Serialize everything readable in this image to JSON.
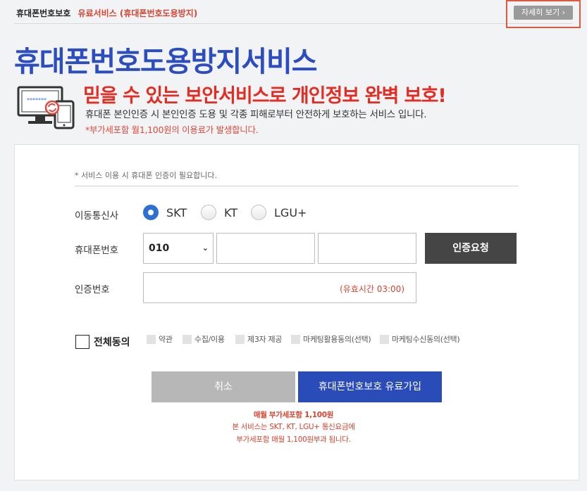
{
  "breadcrumb": {
    "home": "휴대폰번호보호",
    "current": "유료서비스 (휴대폰번호도용방지)"
  },
  "detail_button": "자세히 보기 ›",
  "title": "휴대폰번호도용방지서비스",
  "headline": "믿을 수 있는 보안서비스로 개인정보 완벽 보호!",
  "subtext": "휴대폰 본인인증 시 본인인증 도용 및 각종 피해로부터 안전하게 보호하는 서비스 입니다.",
  "fee_notice": "*부가세포함 월1,100원의 이용료가 발생합니다.",
  "form": {
    "notice": "* 서비스 이용 시 휴대폰 인증이 필요합니다.",
    "carrier_label": "이동통신사",
    "carriers": [
      {
        "label": "SKT",
        "selected": true
      },
      {
        "label": "KT",
        "selected": false
      },
      {
        "label": "LGU+",
        "selected": false
      }
    ],
    "phone_label": "휴대폰번호",
    "phone_prefix": "010",
    "phone_middle": "",
    "phone_last": "",
    "auth_button": "인증요청",
    "code_label": "인증번호",
    "code_value": "",
    "timer": "(유효시간 03:00)"
  },
  "agreements": {
    "all": "전체동의",
    "items": [
      "약관",
      "수집/이용",
      "제3자 제공",
      "마케팅활용동의(선택)",
      "마케팅수신동의(선택)"
    ]
  },
  "buttons": {
    "cancel": "취소",
    "join": "휴대폰번호보호 유료가입"
  },
  "notes": [
    "매월 부가세포함 1,100원",
    "본 서비스는 SKT, KT, LGU+ 통신요금에",
    "부가세포함 매월 1,100원부과 됩니다."
  ],
  "colors": {
    "brand_blue": "#2c4dbf",
    "accent_red": "#e42c23",
    "button_dark": "#454545"
  }
}
